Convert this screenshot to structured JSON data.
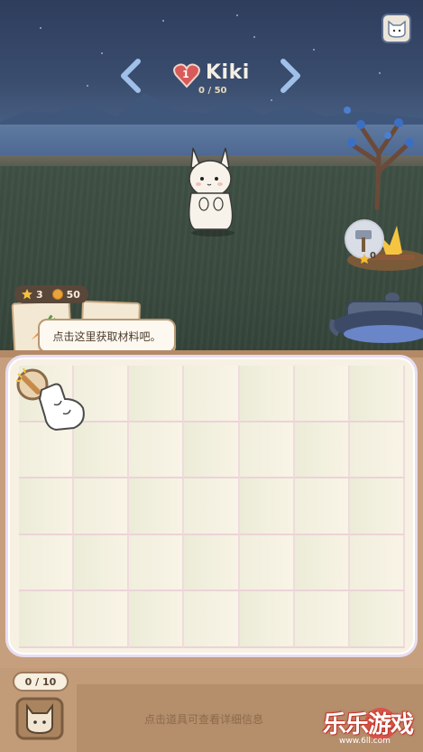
{
  "pet": {
    "level": "1",
    "name": "Kiki",
    "affection": "0 / 50"
  },
  "resources": {
    "stars": "3",
    "coins": "50"
  },
  "craft": {
    "stars": "0"
  },
  "tooltip": {
    "text": "点击这里获取材料吧。"
  },
  "inventory": {
    "count": "0 / 10",
    "hint": "点击道具可查看详细信息"
  },
  "watermark": {
    "text": "乐乐游戏",
    "url": "www.6ll.com"
  },
  "colors": {
    "board": "#c6a07e",
    "panel": "#f7f1e4",
    "accent": "#c23a2e"
  }
}
